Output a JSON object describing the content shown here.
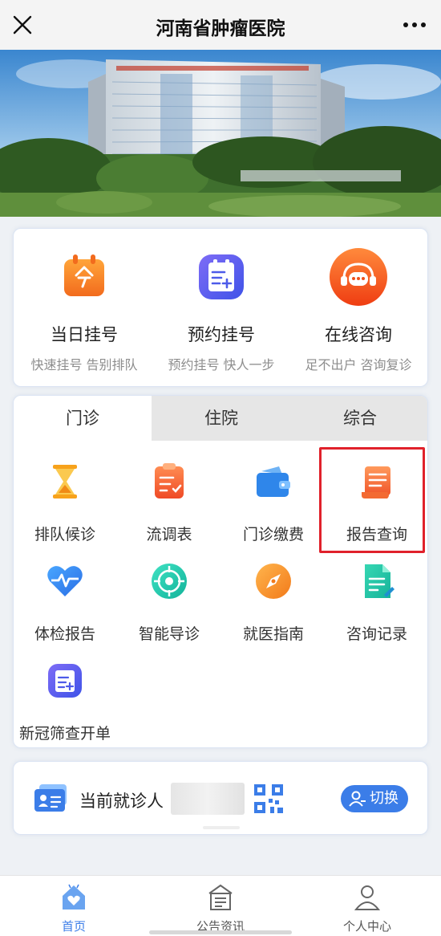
{
  "titlebar": {
    "title": "河南省肿瘤医院",
    "close_icon": "close-icon",
    "more_icon": "more-icon"
  },
  "hero": {
    "alt": "hospital-building-photo"
  },
  "quick_actions": [
    {
      "label": "当日挂号",
      "sub": "快速挂号 告别排队",
      "icon": "calendar-today-icon"
    },
    {
      "label": "预约挂号",
      "sub": "预约挂号 快人一步",
      "icon": "appointment-icon"
    },
    {
      "label": "在线咨询",
      "sub": "足不出户 咨询复诊",
      "icon": "chat-icon"
    }
  ],
  "tabs": [
    {
      "label": "门诊",
      "active": true
    },
    {
      "label": "住院",
      "active": false
    },
    {
      "label": "综合",
      "active": false
    }
  ],
  "services": [
    {
      "label": "排队候诊",
      "icon": "hourglass-icon"
    },
    {
      "label": "流调表",
      "icon": "clipboard-icon"
    },
    {
      "label": "门诊缴费",
      "icon": "wallet-icon"
    },
    {
      "label": "报告查询",
      "icon": "report-icon"
    },
    {
      "label": "体检报告",
      "icon": "heartbeat-icon"
    },
    {
      "label": "智能导诊",
      "icon": "target-icon"
    },
    {
      "label": "就医指南",
      "icon": "compass-icon"
    },
    {
      "label": "咨询记录",
      "icon": "document-icon"
    },
    {
      "label": "新冠筛查开单",
      "icon": "covid-order-icon"
    }
  ],
  "patient": {
    "label": "当前就诊人",
    "switch_label": "切换",
    "card_icon": "id-card-icon",
    "qr_icon": "qr-code-icon"
  },
  "bottom_nav": [
    {
      "label": "首页",
      "icon": "home-icon",
      "active": true
    },
    {
      "label": "公告资讯",
      "icon": "notice-icon",
      "active": false
    },
    {
      "label": "个人中心",
      "icon": "user-icon",
      "active": false
    }
  ],
  "colors": {
    "accent": "#3b7de8",
    "highlight": "#e0212b",
    "orange": "#f06a1d"
  }
}
